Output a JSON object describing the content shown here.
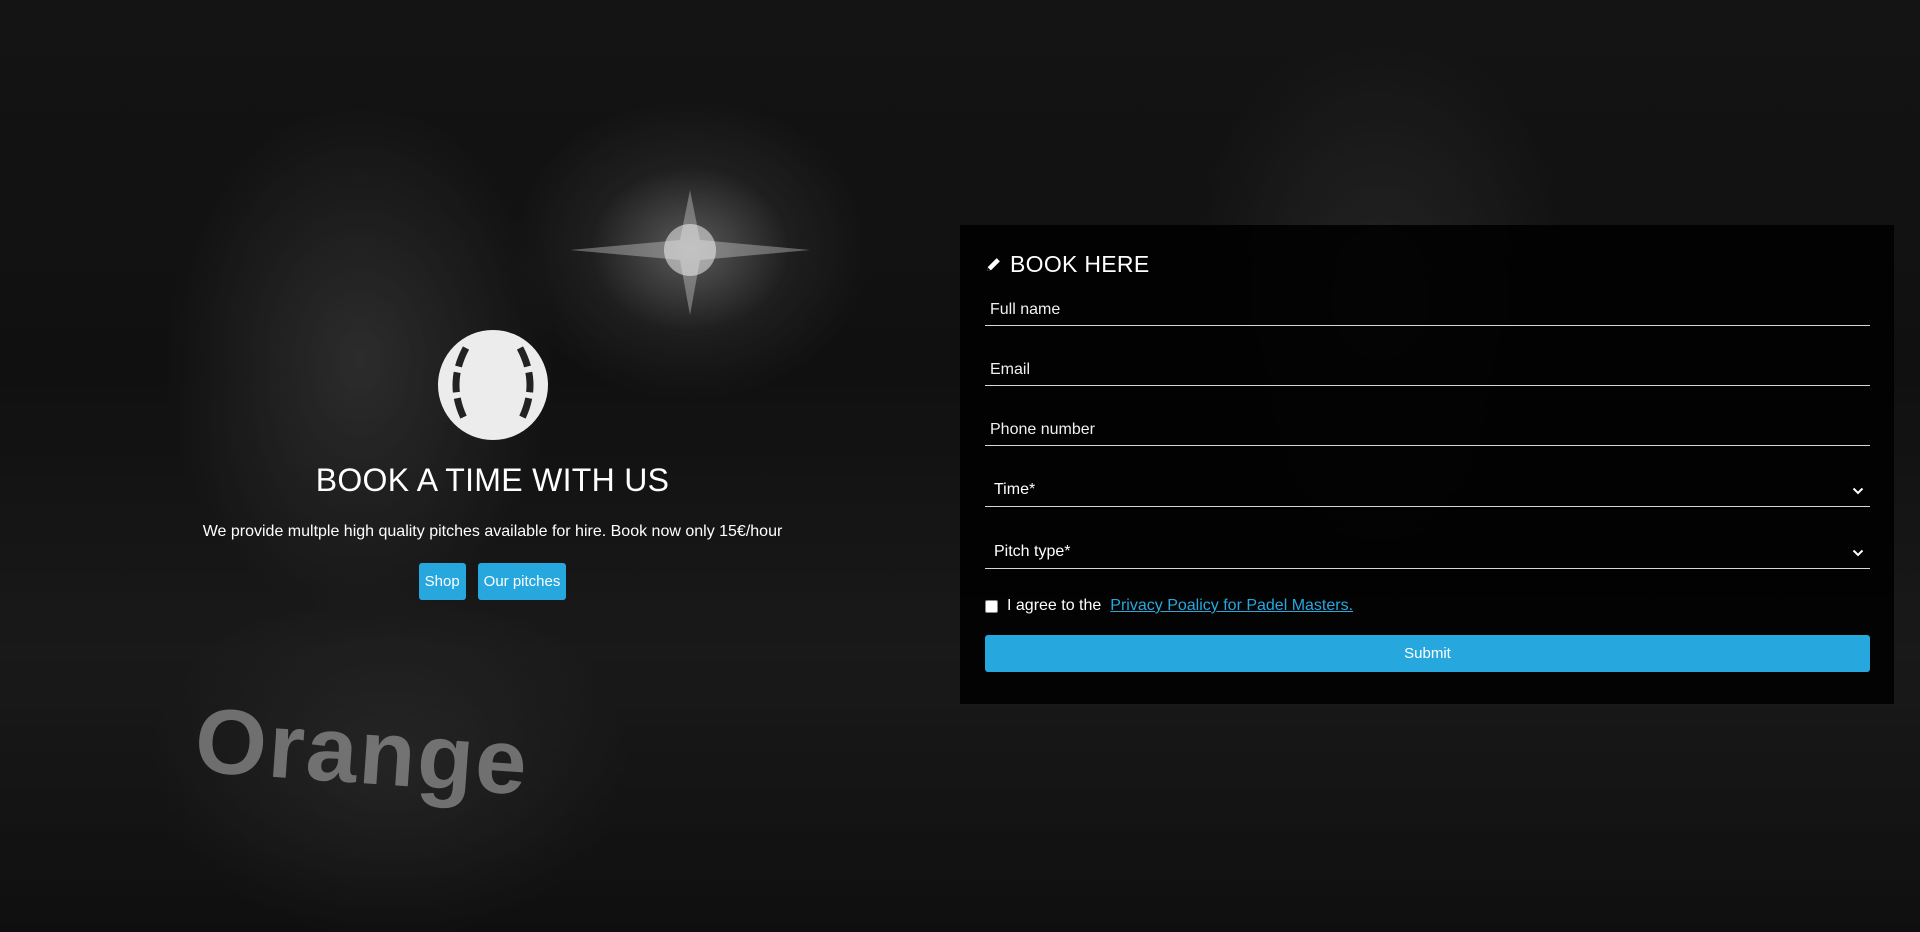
{
  "colors": {
    "accent": "#26a8df",
    "panel": "#000000"
  },
  "background": {
    "jersey_text": "Orange",
    "description": "dark photo of padel players"
  },
  "intro": {
    "icon": "tennis-ball-icon",
    "title": "BOOK A TIME WITH US",
    "description": "We provide multple high quality pitches available for hire. Book now only 15€/hour",
    "buttons": [
      {
        "label": "Shop"
      },
      {
        "label": "Our pitches"
      }
    ]
  },
  "form": {
    "icon": "pencil-icon",
    "title": "BOOK HERE",
    "fields": {
      "full_name": {
        "placeholder": "Full name",
        "value": ""
      },
      "email": {
        "placeholder": "Email",
        "value": ""
      },
      "phone": {
        "placeholder": "Phone number",
        "value": ""
      }
    },
    "selects": {
      "time": {
        "selected": "Time*"
      },
      "pitch_type": {
        "selected": "Pitch type*"
      }
    },
    "agree": {
      "checked": false,
      "prefix": "I agree to the",
      "link_text": "Privacy Poalicy for Padel Masters."
    },
    "submit_label": "Submit"
  }
}
